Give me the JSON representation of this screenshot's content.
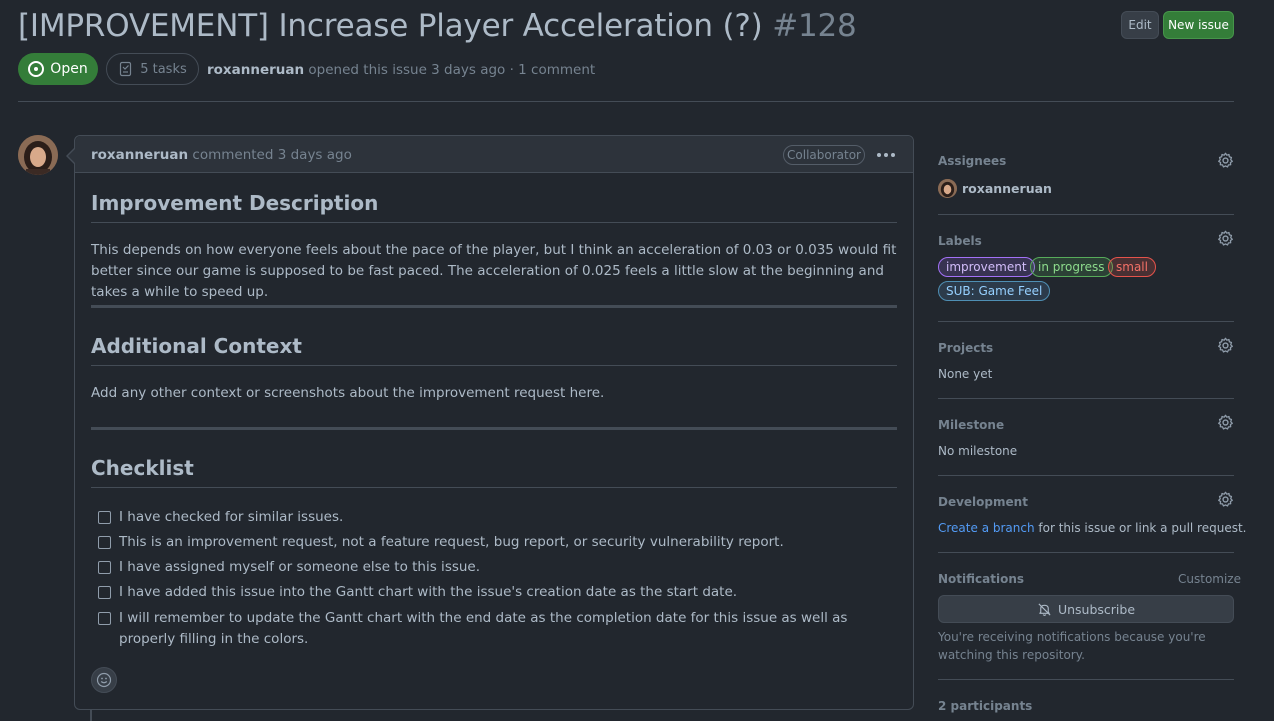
{
  "issue": {
    "title": "[IMPROVEMENT] Increase Player Acceleration (?)",
    "number": "#128",
    "state": "Open",
    "tasks": "5 tasks",
    "author": "roxanneruan",
    "meta_suffix": " opened this issue 3 days ago · 1 comment"
  },
  "header": {
    "edit_label": "Edit",
    "new_issue_label": "New issue"
  },
  "comment": {
    "author": "roxanneruan",
    "action": " commented 3 days ago",
    "role_badge": "Collaborator",
    "sections": [
      {
        "heading": "Improvement Description",
        "body": "This depends on how everyone feels about the pace of the player, but I think an acceleration of 0.03 or 0.035 would fit better since our game is supposed to be fast paced. The acceleration of 0.025 feels a little slow at the beginning and takes a while to speed up."
      },
      {
        "heading": "Additional Context",
        "body": "Add any other context or screenshots about the improvement request here."
      },
      {
        "heading": "Checklist",
        "body": ""
      }
    ],
    "checklist": [
      "I have checked for similar issues.",
      "This is an improvement request, not a feature request, bug report, or security vulnerability report.",
      "I have assigned myself or someone else to this issue.",
      "I have added this issue into the Gantt chart with the issue's creation date as the start date.",
      "I will remember to update the Gantt chart with the end date as the completion date for this issue as well as properly filling in the colors."
    ]
  },
  "sidebar": {
    "assignees": {
      "heading": "Assignees",
      "name": "roxanneruan"
    },
    "labels": {
      "heading": "Labels",
      "items": [
        {
          "text": "improvement",
          "color": "#a371f7"
        },
        {
          "text": "in progress",
          "color": "#57ab5a"
        },
        {
          "text": "small",
          "color": "#e5534b"
        },
        {
          "text": "SUB: Game Feel",
          "color": "#6cb6ff"
        }
      ]
    },
    "projects": {
      "heading": "Projects",
      "value": "None yet"
    },
    "milestone": {
      "heading": "Milestone",
      "value": "No milestone"
    },
    "development": {
      "heading": "Development",
      "link": "Create a branch",
      "rest": " for this issue or link a pull request."
    },
    "notifications": {
      "heading": "Notifications",
      "customize": "Customize",
      "button": "Unsubscribe",
      "note": "You're receiving notifications because you're watching this repository."
    },
    "participants": {
      "heading": "2 participants"
    }
  },
  "colors": {
    "background": "#22272e",
    "accent_green": "#347d39",
    "link_blue": "#539bf5"
  }
}
